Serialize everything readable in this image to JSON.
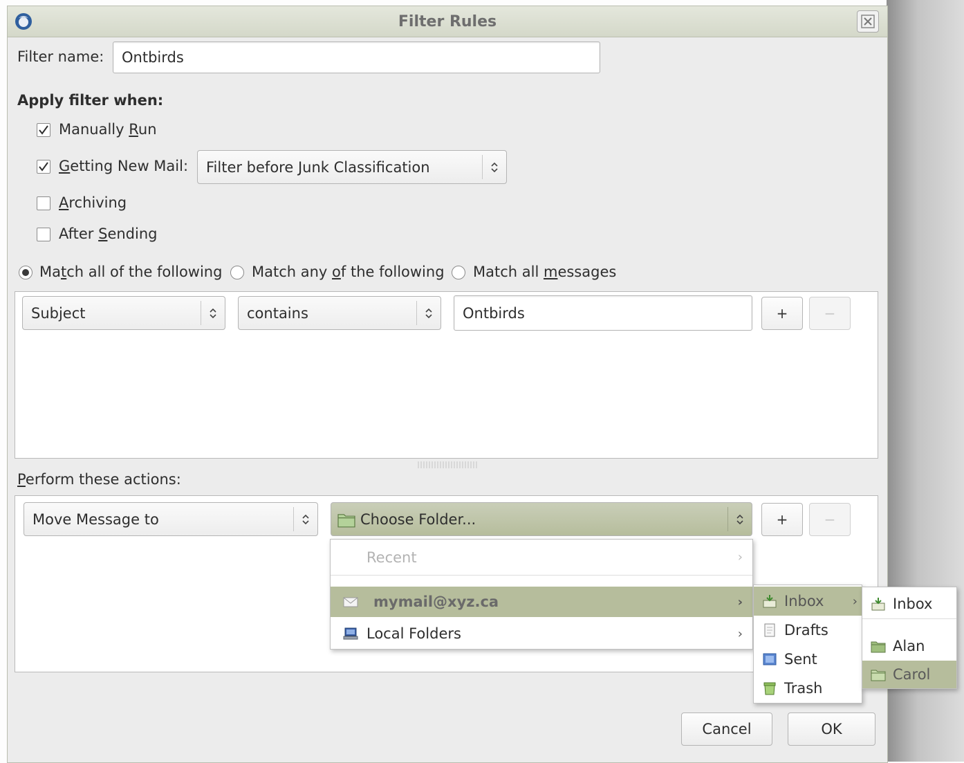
{
  "window": {
    "title": "Filter Rules"
  },
  "filter_name": {
    "label": "Filter name:",
    "value": "Ontbirds"
  },
  "apply_when": {
    "heading": "Apply filter when:",
    "manually_run": {
      "pre": "Manually ",
      "key": "R",
      "post": "un",
      "checked": true
    },
    "getting_new_mail": {
      "pre": "",
      "key": "G",
      "post": "etting New Mail:",
      "checked": true
    },
    "archiving": {
      "pre": "",
      "key": "A",
      "post": "rchiving",
      "checked": false
    },
    "after_sending": {
      "pre": "After ",
      "key": "S",
      "post": "ending",
      "checked": false
    },
    "junk_select": "Filter before Junk Classification"
  },
  "match": {
    "all": {
      "pre": "Ma",
      "key": "t",
      "post": "ch all of the following",
      "selected": true
    },
    "any": {
      "pre": "Match any ",
      "key": "o",
      "post": "f the following",
      "selected": false
    },
    "messages": {
      "pre": "Match all ",
      "key": "m",
      "post": "essages",
      "selected": false
    }
  },
  "condition": {
    "field": "Subject",
    "operator": "contains",
    "value": "Ontbirds",
    "add": "+",
    "remove": "−"
  },
  "actions": {
    "heading_key": "P",
    "heading_rest": "erform these actions:",
    "action": "Move Message to",
    "folder": "Choose Folder...",
    "add": "+",
    "remove": "−"
  },
  "menu_main": {
    "recent": "Recent",
    "account": "mymail@xyz.ca",
    "local": "Local Folders"
  },
  "menu_account": [
    "Inbox",
    "Drafts",
    "Sent",
    "Trash"
  ],
  "menu_inbox": [
    "Inbox",
    "Alan",
    "Carol"
  ],
  "buttons": {
    "cancel": "Cancel",
    "ok": "OK"
  },
  "colors": {
    "highlight": "#b6bd9c",
    "titlebar": "#d8dccd",
    "folder": "#9fbf7e"
  }
}
